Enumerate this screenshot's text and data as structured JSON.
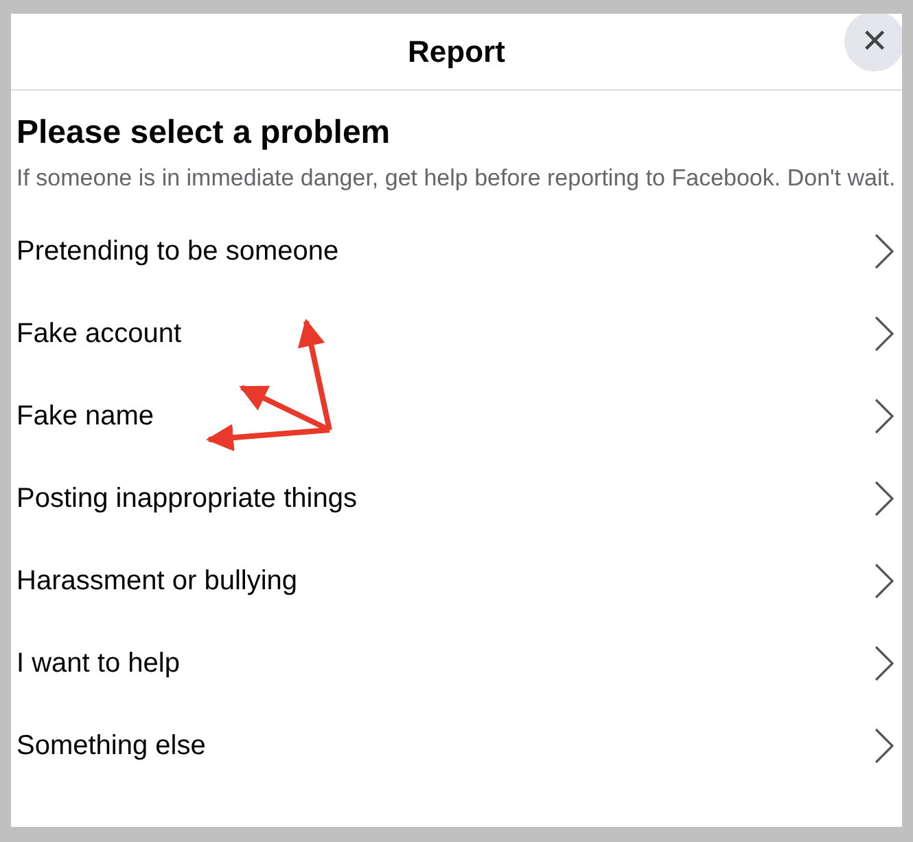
{
  "dialog": {
    "title": "Report",
    "close_label": "✕"
  },
  "heading": "Please select a problem",
  "description": "If someone is in immediate danger, get help before reporting to Facebook. Don't wait.",
  "options": [
    {
      "label": "Pretending to be someone"
    },
    {
      "label": "Fake account"
    },
    {
      "label": "Fake name"
    },
    {
      "label": "Posting inappropriate things"
    },
    {
      "label": "Harassment or bullying"
    },
    {
      "label": "I want to help"
    },
    {
      "label": "Something else"
    }
  ]
}
